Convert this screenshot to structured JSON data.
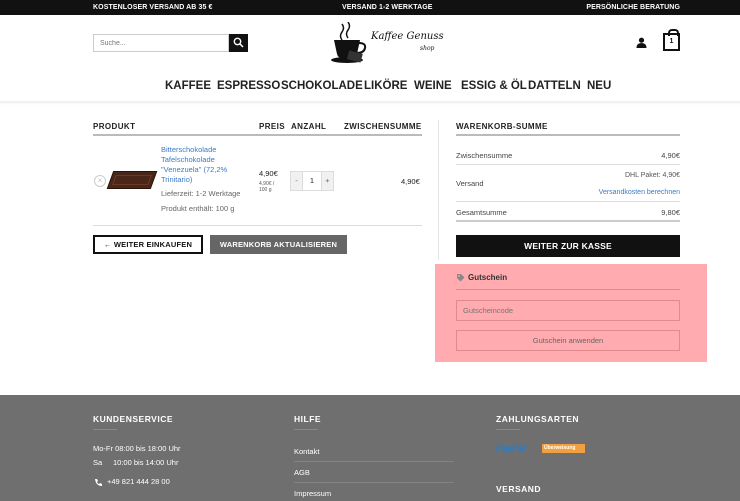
{
  "topbar": {
    "left": "KOSTENLOSER VERSAND AB 35 €",
    "center": "VERSAND 1-2 WERKTAGE",
    "right": "PERSÖNLICHE BERATUNG"
  },
  "header": {
    "search_placeholder": "Suche...",
    "logo_text": "Kaffee Genuss",
    "logo_sub": "shop",
    "cart_count": "1"
  },
  "nav": [
    "KAFFEE",
    "ESPRESSO",
    "SCHOKOLADE",
    "LIKÖRE",
    "WEINE",
    "ESSIG & ÖL",
    "DATTELN",
    "NEU"
  ],
  "cart": {
    "headers": {
      "product": "PRODUKT",
      "price": "PREIS",
      "quantity": "ANZAHL",
      "subtotal": "ZWISCHENSUMME"
    },
    "item": {
      "remove": "×",
      "name": "Bitterschokolade Tafelschokolade \"Venezuela\" (72,2% Trinitario)",
      "delivery": "Lieferzeit: 1-2 Werktage",
      "contents": "Produkt enthält: 100 g",
      "price": "4,90€",
      "unit_price": "4,90€ /",
      "unit_qty": "100 g",
      "quantity": "1",
      "minus": "-",
      "plus": "+",
      "subtotal": "4,90€"
    },
    "continue_button": "← WEITER EINKAUFEN",
    "update_button": "WARENKORB AKTUALISIEREN"
  },
  "totals": {
    "title": "WARENKORB-SUMME",
    "subtotal_label": "Zwischensumme",
    "subtotal_value": "4,90€",
    "shipping_label": "Versand",
    "shipping_value": "DHL Paket: 4,90€",
    "shipping_calc": "Versandkosten berechnen",
    "total_label": "Gesamtsumme",
    "total_value": "9,80€",
    "checkout_button": "WEITER ZUR KASSE"
  },
  "coupon": {
    "title": "Gutschein",
    "placeholder": "Gutscheincode",
    "apply_button": "Gutschein anwenden"
  },
  "footer": {
    "service": {
      "title": "KUNDENSERVICE",
      "hours1": "Mo-Fr 08:00 bis 18:00 Uhr",
      "hours2_day": "Sa",
      "hours2_time": "10:00 bis 14:00 Uhr",
      "phone": "+49 821 444 28 00"
    },
    "help": {
      "title": "HILFE",
      "links": [
        "Kontakt",
        "AGB",
        "Impressum"
      ]
    },
    "payment": {
      "title": "ZAHLUNGSARTEN",
      "paypal": "PayPal",
      "transfer": "Überweisung",
      "shipping_title": "VERSAND"
    }
  },
  "colors": {
    "accent_link": "#3a7bc8",
    "coupon_highlight": "#ffabb0",
    "footer_bg": "#6f6f6f"
  }
}
